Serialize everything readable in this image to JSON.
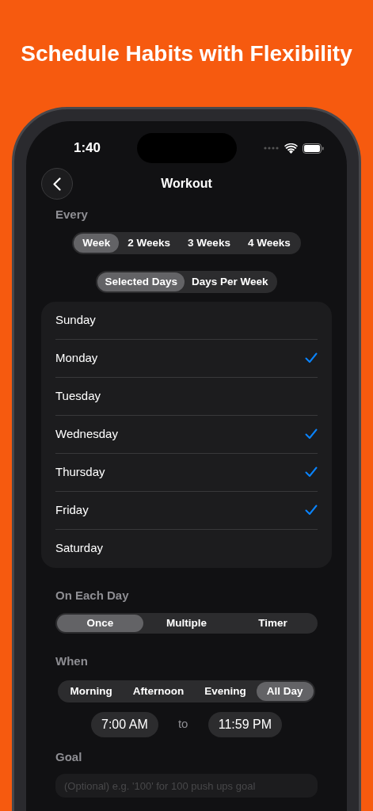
{
  "headline": "Schedule Habits with Flexibility",
  "status_bar": {
    "time": "1:40"
  },
  "nav": {
    "title": "Workout"
  },
  "every": {
    "label": "Every",
    "options": [
      {
        "label": "Week",
        "selected": true
      },
      {
        "label": "2 Weeks",
        "selected": false
      },
      {
        "label": "3 Weeks",
        "selected": false
      },
      {
        "label": "4 Weeks",
        "selected": false
      }
    ]
  },
  "day_mode": {
    "options": [
      {
        "label": "Selected Days",
        "selected": true
      },
      {
        "label": "Days Per Week",
        "selected": false
      }
    ]
  },
  "days": [
    {
      "label": "Sunday",
      "checked": false
    },
    {
      "label": "Monday",
      "checked": true
    },
    {
      "label": "Tuesday",
      "checked": false
    },
    {
      "label": "Wednesday",
      "checked": true
    },
    {
      "label": "Thursday",
      "checked": true
    },
    {
      "label": "Friday",
      "checked": true
    },
    {
      "label": "Saturday",
      "checked": false
    }
  ],
  "on_each_day": {
    "label": "On Each Day",
    "options": [
      {
        "label": "Once",
        "selected": true
      },
      {
        "label": "Multiple",
        "selected": false
      },
      {
        "label": "Timer",
        "selected": false
      }
    ]
  },
  "when": {
    "label": "When",
    "options": [
      {
        "label": "Morning",
        "selected": false
      },
      {
        "label": "Afternoon",
        "selected": false
      },
      {
        "label": "Evening",
        "selected": false
      },
      {
        "label": "All Day",
        "selected": true
      }
    ],
    "start": "7:00 AM",
    "separator": "to",
    "end": "11:59 PM"
  },
  "goal": {
    "label": "Goal",
    "placeholder": "(Optional) e.g. '100' for 100 push ups goal"
  }
}
